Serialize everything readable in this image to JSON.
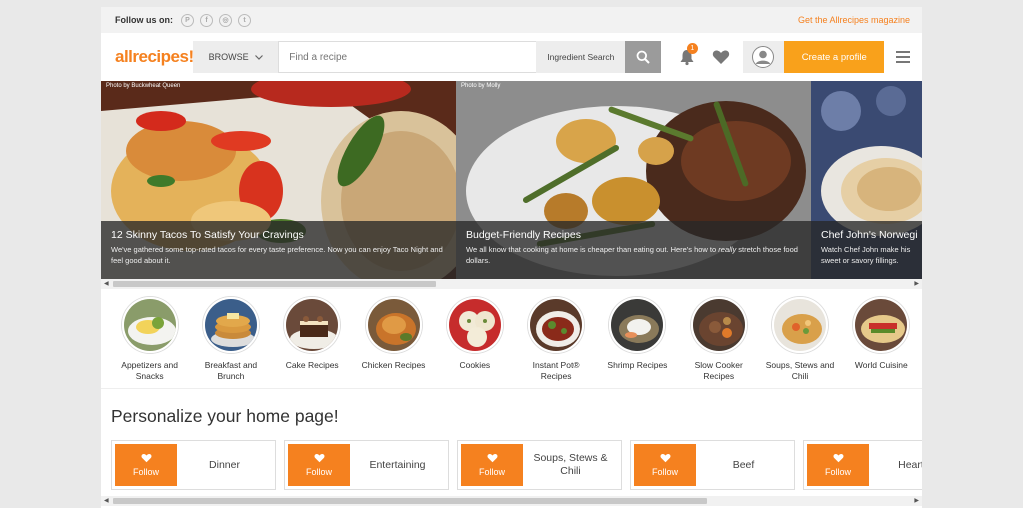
{
  "topbar": {
    "follow_label": "Follow us on:",
    "social": [
      "pinterest-icon",
      "facebook-icon",
      "instagram-icon",
      "twitter-icon"
    ],
    "magazine_link": "Get the Allrecipes magazine"
  },
  "header": {
    "logo": "allrecipes",
    "browse_label": "BROWSE",
    "search_placeholder": "Find a recipe",
    "ingredient_search_label": "Ingredient Search",
    "notification_count": "1",
    "create_profile_label": "Create a profile"
  },
  "carousel": [
    {
      "credit": "Photo by Buckwheat Queen",
      "title": "12 Skinny Tacos To Satisfy Your Cravings",
      "description": "We've gathered some top-rated tacos for every taste preference. Now you can enjoy Taco Night and feel good about it."
    },
    {
      "credit": "Photo by Molly",
      "title": "Budget-Friendly Recipes",
      "description_pre": "We all know that cooking at home is cheaper than eating out. Here's how to ",
      "description_em": "really",
      "description_post": " stretch those food dollars."
    },
    {
      "credit": "",
      "title": "Chef John's Norwegi",
      "description": "Watch Chef John make his sweet or savory fillings."
    }
  ],
  "categories": [
    {
      "label": "Appetizers and Snacks"
    },
    {
      "label": "Breakfast and Brunch"
    },
    {
      "label": "Cake Recipes"
    },
    {
      "label": "Chicken Recipes"
    },
    {
      "label": "Cookies"
    },
    {
      "label": "Instant Pot® Recipes"
    },
    {
      "label": "Shrimp Recipes"
    },
    {
      "label": "Slow Cooker Recipes"
    },
    {
      "label": "Soups, Stews and Chili"
    },
    {
      "label": "World Cuisine"
    }
  ],
  "personalize": {
    "title": "Personalize your home page!",
    "follow_label": "Follow",
    "cards": [
      {
        "name": "Dinner"
      },
      {
        "name": "Entertaining"
      },
      {
        "name": "Soups, Stews & Chili"
      },
      {
        "name": "Beef"
      },
      {
        "name": "Heart-H"
      }
    ]
  },
  "colors": {
    "brand_orange": "#f5811f",
    "create_profile": "#f9a11b"
  }
}
